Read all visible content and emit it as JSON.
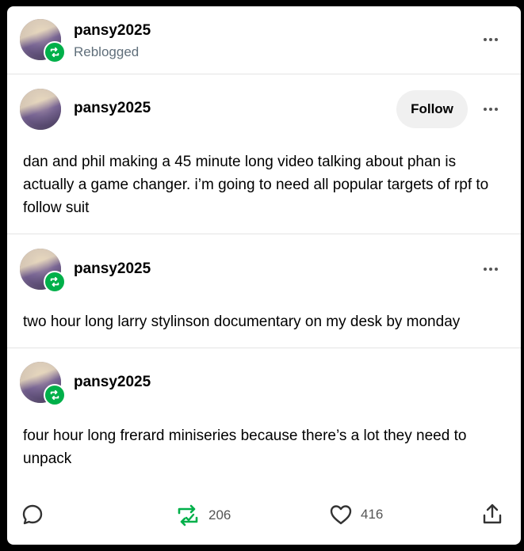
{
  "header": {
    "username": "pansy2025",
    "status": "Reblogged"
  },
  "posts": [
    {
      "username": "pansy2025",
      "follow_label": "Follow",
      "text": "dan and phil making a 45 minute long video talking about phan is actually a game changer. i’m going to need all popular targets of rpf to follow suit"
    },
    {
      "username": "pansy2025",
      "text": "two hour long larry stylinson documentary  on my desk by monday"
    },
    {
      "username": "pansy2025",
      "text": "four hour long frerard miniseries because there’s a lot they need to unpack"
    }
  ],
  "footer": {
    "reblog_count": "206",
    "like_count": "416"
  },
  "colors": {
    "reblog_green": "#00b04a",
    "muted_text": "#606f7b",
    "follow_bg": "#f0f0f0"
  },
  "icons": [
    "reblog-icon",
    "more-icon",
    "comment-icon",
    "heart-icon",
    "share-icon"
  ]
}
